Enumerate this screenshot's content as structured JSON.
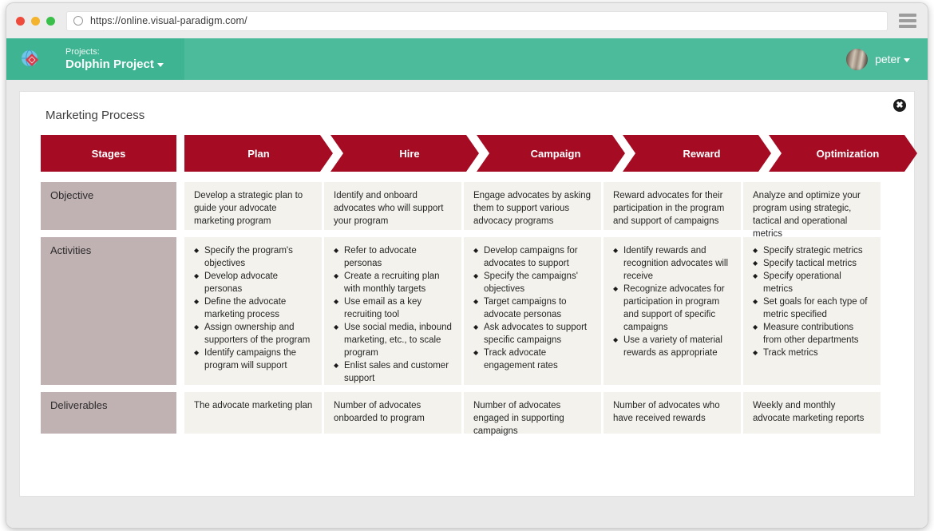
{
  "browser": {
    "url": "https://online.visual-paradigm.com/",
    "reload_icon": "reload-icon",
    "menu_icon": "hamburger-menu-icon"
  },
  "app_header": {
    "logo_icon": "visual-paradigm-logo-icon",
    "project_label": "Projects:",
    "project_name": "Dolphin Project",
    "project_caret_icon": "chevron-down-icon",
    "user_name": "peter",
    "user_caret_icon": "chevron-down-icon",
    "avatar_icon": "user-avatar",
    "bar_color": "#4cbb9b"
  },
  "card": {
    "title": "Marketing Process",
    "close_label": "✖",
    "close_icon": "close-icon"
  },
  "matrix": {
    "colors": {
      "header_red": "#A50C23",
      "label_mauve": "#C0B1B3",
      "cell_cream": "#F3F2EC"
    },
    "headers": [
      "Stages",
      "Plan",
      "Hire",
      "Campaign",
      "Reward",
      "Optimization"
    ],
    "rows": [
      {
        "label": "Objective",
        "type": "text",
        "cells": [
          "Develop a strategic plan to guide your advocate marketing program",
          "Identify and onboard advocates who will support your program",
          "Engage advocates by asking them to support various advocacy programs",
          "Reward advocates for their participation in the program and support of campaigns",
          "Analyze and optimize your program using strategic, tactical and operational metrics"
        ]
      },
      {
        "label": "Activities",
        "type": "bullets",
        "cells": [
          [
            "Specify the program's objectives",
            "Develop advocate personas",
            "Define the advocate marketing process",
            "Assign ownership and supporters of the program",
            "Identify campaigns the program will support"
          ],
          [
            "Refer to advocate personas",
            "Create a recruiting plan with monthly targets",
            "Use email as a key recruiting tool",
            "Use social media, inbound marketing, etc., to scale program",
            "Enlist sales and customer support"
          ],
          [
            "Develop campaigns for advocates to support",
            "Specify the campaigns' objectives",
            "Target campaigns to advocate personas",
            "Ask advocates to support specific campaigns",
            "Track advocate engagement rates"
          ],
          [
            "Identify rewards and recognition advocates will receive",
            "Recognize advocates for participation in program and support of specific campaigns",
            "Use a variety of material rewards as appropriate"
          ],
          [
            "Specify strategic metrics",
            "Specify tactical metrics",
            "Specify operational metrics",
            "Set goals for each type of metric specified",
            "Measure contributions from other departments",
            "Track metrics"
          ]
        ]
      },
      {
        "label": "Deliverables",
        "type": "text",
        "cells": [
          "The advocate marketing plan",
          "Number of advocates onboarded to program",
          "Number of advocates engaged in supporting campaigns",
          "Number of advocates who have received rewards",
          "Weekly and monthly advocate marketing reports"
        ]
      }
    ]
  }
}
